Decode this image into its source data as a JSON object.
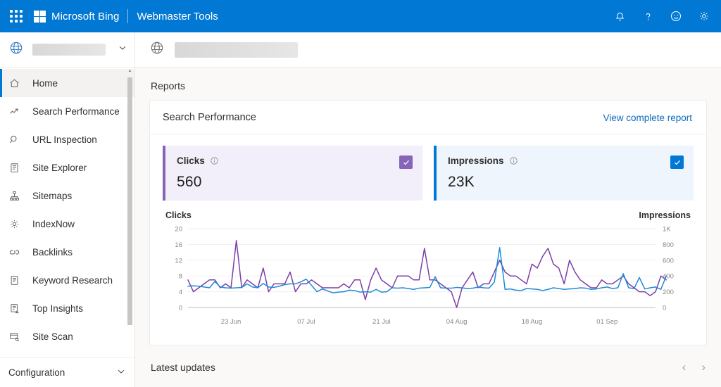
{
  "suitebar": {
    "waffle_label": "App launcher",
    "brand": "Microsoft Bing",
    "app_name": "Webmaster Tools",
    "icons": [
      "notifications-bell-icon",
      "help-question-icon",
      "feedback-smiley-icon",
      "settings-gear-icon"
    ],
    "background": "#0078D4"
  },
  "sidebar": {
    "site_selector": {
      "icon": "globe-icon",
      "value": "",
      "redacted": true,
      "chevron": "chevron-down-icon"
    },
    "items": [
      {
        "label": "Home",
        "icon": "home-icon",
        "active": true
      },
      {
        "label": "Search Performance",
        "icon": "trending-up-icon",
        "active": false
      },
      {
        "label": "URL Inspection",
        "icon": "magnifier-icon",
        "active": false
      },
      {
        "label": "Site Explorer",
        "icon": "document-list-icon",
        "active": false
      },
      {
        "label": "Sitemaps",
        "icon": "sitemap-tree-icon",
        "active": false
      },
      {
        "label": "IndexNow",
        "icon": "gear-icon",
        "active": false
      },
      {
        "label": "Backlinks",
        "icon": "chain-links-icon",
        "active": false
      },
      {
        "label": "Keyword Research",
        "icon": "document-lines-icon",
        "active": false
      },
      {
        "label": "Top Insights",
        "icon": "insights-icon",
        "active": false
      },
      {
        "label": "Site Scan",
        "icon": "site-scan-icon",
        "active": false
      }
    ],
    "footer": {
      "label": "Configuration",
      "chevron": "chevron-down-icon"
    }
  },
  "main_header": {
    "icon": "globe-icon",
    "site_value": "",
    "redacted": true
  },
  "reports": {
    "section_title": "Reports",
    "card": {
      "title": "Search Performance",
      "link": "View complete report",
      "tiles": [
        {
          "name": "Clicks",
          "value": "560",
          "info_icon": "info-icon",
          "checked": true,
          "accent": "#8764B8",
          "background": "#f2eefa"
        },
        {
          "name": "Impressions",
          "value": "23K",
          "info_icon": "info-icon",
          "checked": true,
          "accent": "#0078D4",
          "background": "#eef5fc"
        }
      ]
    }
  },
  "latest_updates": {
    "title": "Latest updates",
    "prev_icon": "chevron-left-icon",
    "next_icon": "chevron-right-icon"
  },
  "chart_data": {
    "type": "line",
    "title": "",
    "left_axis_label": "Clicks",
    "right_axis_label": "Impressions",
    "xlabel": "",
    "grid": true,
    "legend": "axis-labels",
    "left_ticks": [
      0,
      4,
      8,
      12,
      16,
      20
    ],
    "right_ticks": [
      "0",
      "200",
      "400",
      "600",
      "800",
      "1K"
    ],
    "ylim_left": [
      0,
      20
    ],
    "ylim_right": [
      0,
      1000
    ],
    "x_tick_labels": [
      "23 Jun",
      "07 Jul",
      "21 Jul",
      "04 Aug",
      "18 Aug",
      "01 Sep"
    ],
    "x_tick_index": [
      8,
      22,
      36,
      50,
      64,
      78
    ],
    "n_points": 88,
    "series": [
      {
        "name": "Clicks",
        "color": "#7C3FA8",
        "axis": "left",
        "values": [
          7,
          4,
          5,
          6,
          7,
          7,
          5,
          6,
          5,
          17,
          5,
          7,
          6,
          5,
          10,
          4,
          6,
          6,
          6,
          9,
          4,
          6,
          6,
          7,
          6,
          5,
          5,
          5,
          5,
          6,
          5,
          7,
          7,
          2,
          7,
          10,
          7,
          6,
          5,
          8,
          8,
          8,
          7,
          7,
          15,
          7,
          7,
          6,
          5,
          4,
          0,
          5,
          7,
          9,
          5,
          6,
          6,
          9,
          12,
          9,
          8,
          8,
          7,
          6,
          11,
          10,
          13,
          15,
          11,
          10,
          6,
          12,
          9,
          7,
          6,
          5,
          5,
          7,
          6,
          6,
          7,
          8,
          6,
          5,
          4,
          4,
          3,
          4,
          8,
          7
        ]
      },
      {
        "name": "Impressions",
        "color": "#1E8BD6",
        "axis": "right",
        "values": [
          270,
          275,
          270,
          260,
          250,
          330,
          260,
          250,
          245,
          250,
          255,
          300,
          260,
          250,
          305,
          260,
          255,
          270,
          290,
          300,
          300,
          325,
          360,
          280,
          200,
          235,
          210,
          185,
          195,
          200,
          220,
          215,
          195,
          200,
          195,
          230,
          195,
          200,
          250,
          245,
          250,
          240,
          230,
          245,
          250,
          255,
          390,
          250,
          245,
          245,
          255,
          250,
          240,
          245,
          260,
          250,
          245,
          320,
          760,
          230,
          235,
          220,
          215,
          240,
          235,
          230,
          215,
          230,
          250,
          240,
          230,
          235,
          240,
          250,
          245,
          230,
          235,
          250,
          260,
          240,
          250,
          430,
          250,
          240,
          380,
          235,
          250,
          260,
          230,
          400
        ]
      }
    ]
  }
}
